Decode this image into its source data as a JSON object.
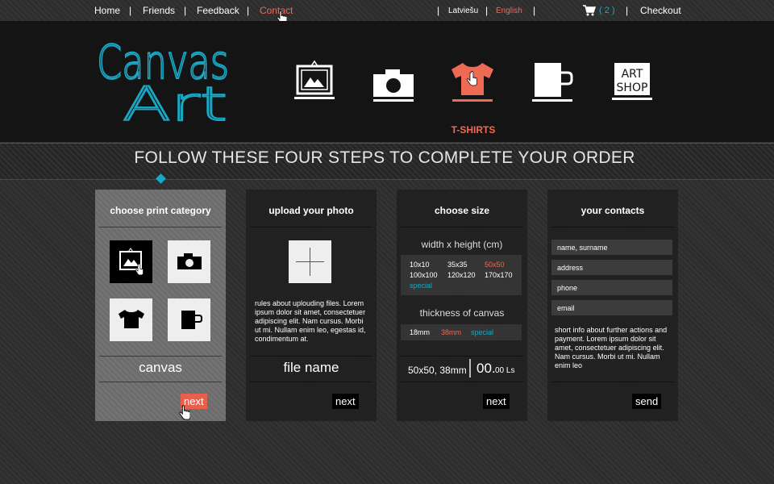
{
  "nav": {
    "home": "Home",
    "friends": "Friends",
    "feedback": "Feedback",
    "contact": "Contact",
    "separator": "|",
    "lang_lv": "Latviešu",
    "lang_en": "English",
    "cart_count": "( 2 )",
    "checkout": "Checkout"
  },
  "header": {
    "logo_line1": "Canvas",
    "logo_line2": "Art",
    "active_category_label": "T-SHIRTS",
    "artshop_line1": "ART",
    "artshop_line2": "SHOP"
  },
  "page_title": "FOLLOW THESE FOUR STEPS TO COMPLETE YOUR ORDER",
  "step1": {
    "title": "choose print category",
    "selected": "canvas",
    "next": "next"
  },
  "step2": {
    "title": "upload your photo",
    "rules": "rules about uplouding files. Lorem ipsum dolor sit amet, consectetuer adipiscing elit. Nam cursus. Morbi ut mi. Nullam enim leo, egestas id, condimentum at.",
    "file_name": "file name",
    "next": "next"
  },
  "step3": {
    "title": "choose size",
    "size_heading": "width x height (cm)",
    "sizes": [
      "10x10",
      "35x35",
      "50x50",
      "100x100",
      "120x120",
      "170x170",
      "special"
    ],
    "thickness_heading": "thickness of canvas",
    "thickness": [
      "18mm",
      "38mm",
      "special"
    ],
    "summary": "50x50, 38mm",
    "price_main": "00.",
    "price_small": "00 Ls",
    "next": "next"
  },
  "step4": {
    "title": "your contacts",
    "name_placeholder": "name, surname",
    "address_placeholder": "address",
    "phone_placeholder": "phone",
    "email_placeholder": "email",
    "info": "short info about further actions and payment.   Lorem ipsum dolor sit amet, consectetuer adipiscing elit. Nam cursus. Morbi ut mi. Nullam enim leo",
    "send": "send"
  },
  "colors": {
    "accent_red": "#ef6a55",
    "accent_blue": "#18a9c6"
  }
}
